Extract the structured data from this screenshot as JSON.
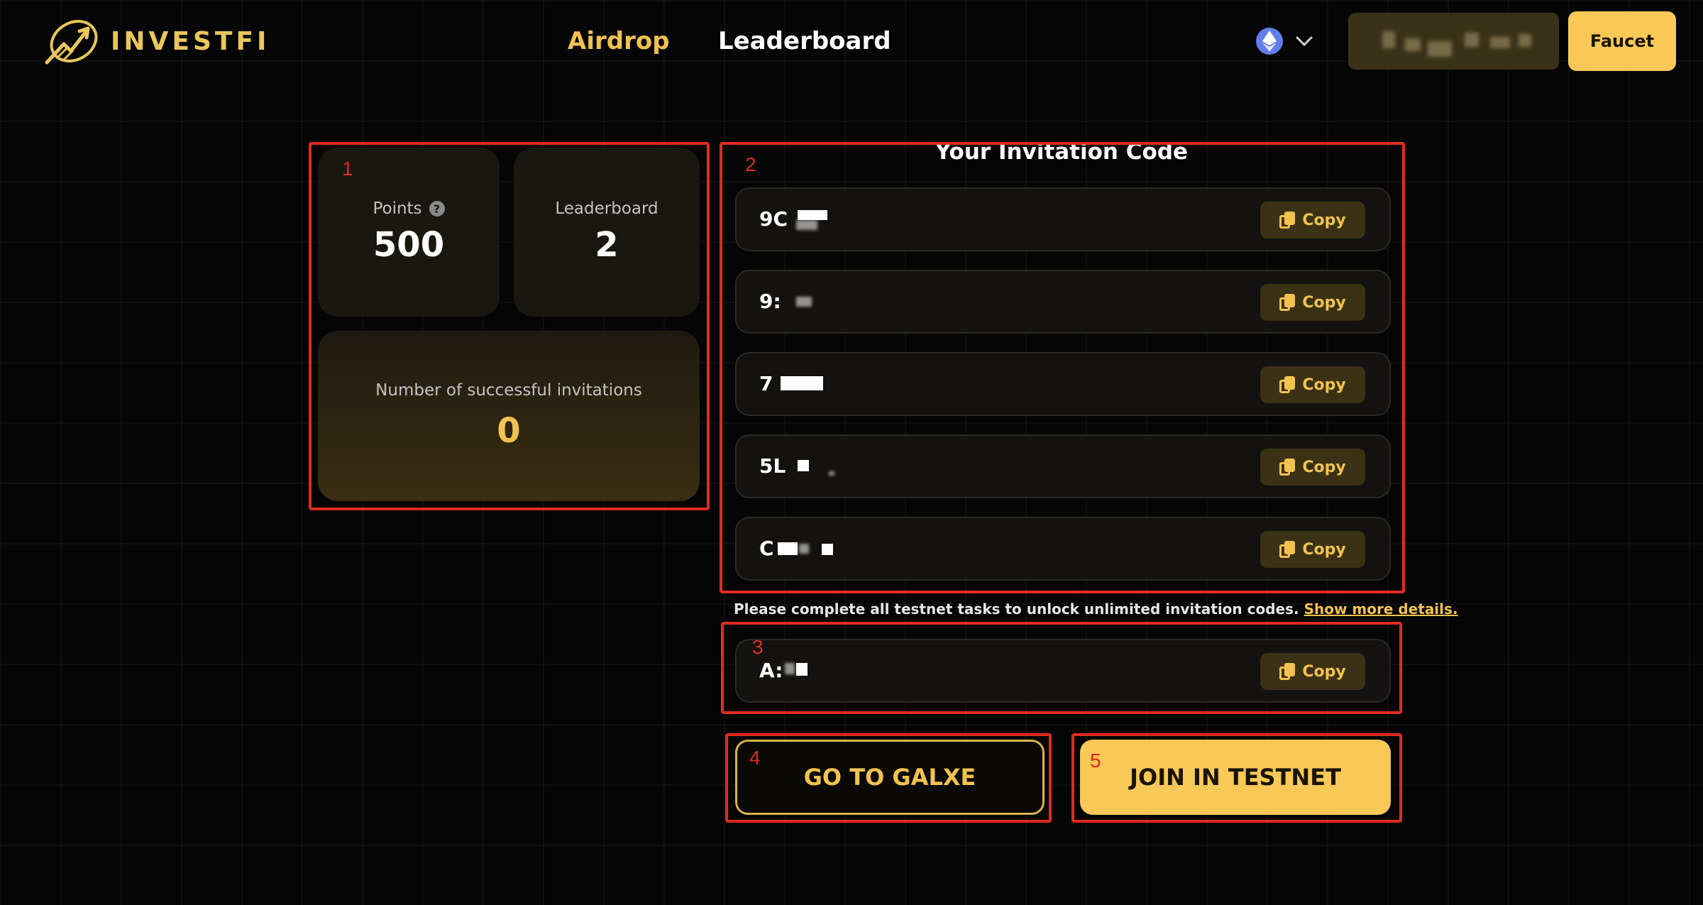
{
  "header": {
    "logo_text": "INVESTFI",
    "nav": [
      {
        "label": "Airdrop",
        "active": true
      },
      {
        "label": "Leaderboard",
        "active": false
      }
    ],
    "faucet_label": "Faucet",
    "network_icon": "ethereum-icon"
  },
  "stats": {
    "points_label": "Points",
    "points_value": "500",
    "leaderboard_label": "Leaderboard",
    "leaderboard_value": "2",
    "invitations_label": "Number of successful invitations",
    "invitations_value": "0"
  },
  "invitation": {
    "title": "Your Invitation Code",
    "codes": [
      {
        "code_prefix": "9C",
        "copy_label": "Copy"
      },
      {
        "code_prefix": "9:",
        "copy_label": "Copy"
      },
      {
        "code_prefix": "7",
        "copy_label": "Copy"
      },
      {
        "code_prefix": "5L",
        "copy_label": "Copy"
      },
      {
        "code_prefix": "C",
        "copy_label": "Copy"
      }
    ],
    "notice_text": "Please complete all testnet tasks to unlock unlimited invitation codes.",
    "notice_link": "Show more details.",
    "extra_code": {
      "code_prefix": "A:",
      "copy_label": "Copy"
    }
  },
  "actions": {
    "galxe_label": "GO TO GALXE",
    "testnet_label": "JOIN IN TESTNET"
  },
  "annotations": [
    "1",
    "2",
    "3",
    "4",
    "5"
  ],
  "colors": {
    "accent": "#f2c24e",
    "button_fill": "#f8c957",
    "annotation": "#e02a20",
    "background": "#050505"
  }
}
